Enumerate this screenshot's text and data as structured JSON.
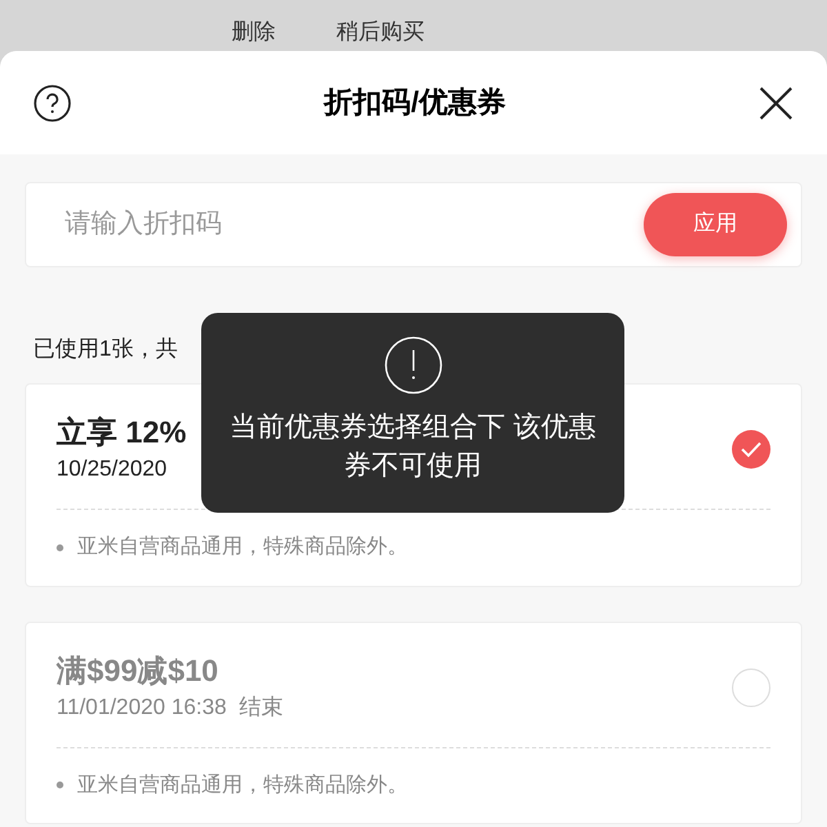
{
  "background_actions": [
    "删除",
    "稍后购买"
  ],
  "sheet": {
    "title": "折扣码/优惠券"
  },
  "code_input": {
    "placeholder": "请输入折扣码",
    "button": "应用"
  },
  "summary": "已使用1张，共",
  "coupons": [
    {
      "title": "立享 12%",
      "expiry": "10/25/2020",
      "note": "亚米自营商品通用，特殊商品除外。",
      "selected": true,
      "disabled": false
    },
    {
      "title": "满$99减$10",
      "expiry": "11/01/2020 16:38  结束",
      "note": "亚米自营商品通用，特殊商品除外。",
      "selected": false,
      "disabled": true
    }
  ],
  "toast": {
    "message": "当前优惠券选择组合下 该优惠券不可使用"
  }
}
